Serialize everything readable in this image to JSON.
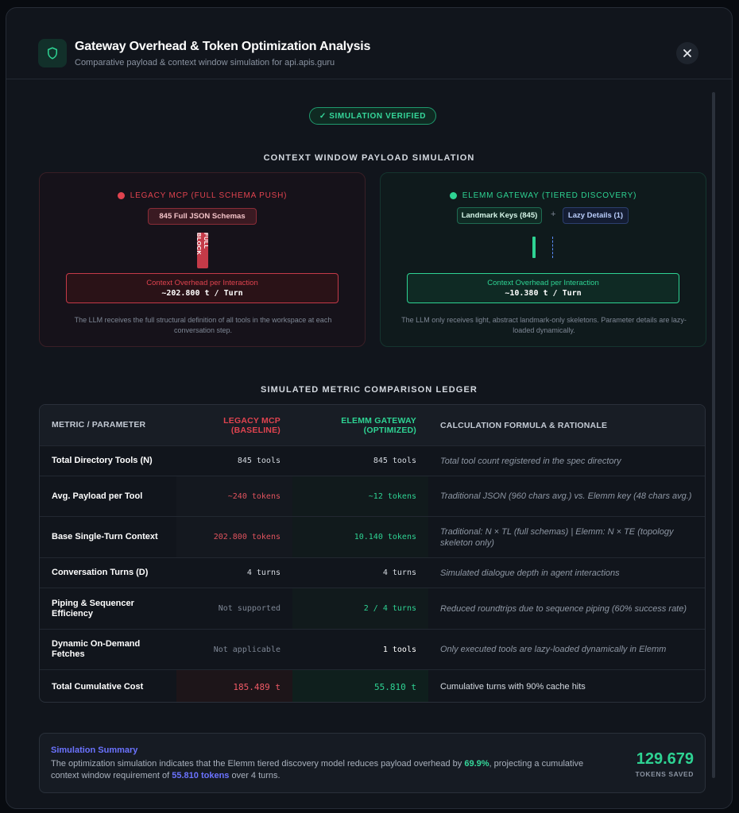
{
  "header": {
    "title": "Gateway Overhead & Token Optimization Analysis",
    "subtitle": "Comparative payload & context window simulation for api.apis.guru",
    "icon": "shield-icon",
    "close_icon": "close-icon"
  },
  "badge": "✓ SIMULATION VERIFIED",
  "simulation": {
    "heading": "CONTEXT WINDOW PAYLOAD SIMULATION",
    "legacy": {
      "title": "LEGACY MCP (FULL SCHEMA PUSH)",
      "chip": "845 Full JSON Schemas",
      "block_label": "FULL BLOCK",
      "overhead_label": "Context Overhead per Interaction",
      "overhead_value": "~202.800 t / Turn",
      "description": "The LLM receives the full structural definition of all tools in the workspace at each conversation step.",
      "color": "#e0434f"
    },
    "elemm": {
      "title": "ELEMM GATEWAY (TIERED DISCOVERY)",
      "chip_keys": "Landmark Keys (845)",
      "plus": "+",
      "chip_lazy": "Lazy Details (1)",
      "overhead_label": "Context Overhead per Interaction",
      "overhead_value": "~10.380 t / Turn",
      "description": "The LLM only receives light, abstract landmark-only skeletons. Parameter details are lazy-loaded dynamically.",
      "color": "#2ed393"
    }
  },
  "ledger": {
    "heading": "SIMULATED METRIC COMPARISON LEDGER",
    "columns": {
      "metric": "METRIC / PARAMETER",
      "legacy_line1": "LEGACY MCP",
      "legacy_line2": "(BASELINE)",
      "elemm_line1": "ELEMM GATEWAY",
      "elemm_line2": "(OPTIMIZED)",
      "formula": "CALCULATION FORMULA & RATIONALE"
    },
    "rows": [
      {
        "metric": "Total Directory Tools (N)",
        "legacy": "845 tools",
        "elemm": "845 tools",
        "formula": "Total tool count registered in the spec directory"
      },
      {
        "metric": "Avg. Payload per Tool",
        "legacy": "~240 tokens",
        "elemm": "~12 tokens",
        "formula": "Traditional JSON (960 chars avg.) vs. Elemm key (48 chars avg.)"
      },
      {
        "metric": "Base Single-Turn Context",
        "legacy": "202.800 tokens",
        "elemm": "10.140 tokens",
        "formula": "Traditional: N × TL (full schemas) | Elemm: N × TE (topology skeleton only)"
      },
      {
        "metric": "Conversation Turns (D)",
        "legacy": "4 turns",
        "elemm": "4 turns",
        "formula": "Simulated dialogue depth in agent interactions"
      },
      {
        "metric": "Piping & Sequencer Efficiency",
        "legacy": "Not supported",
        "elemm": "2 / 4 turns",
        "formula": "Reduced roundtrips due to sequence piping (60% success rate)"
      },
      {
        "metric": "Dynamic On-Demand Fetches",
        "legacy": "Not applicable",
        "elemm": "1 tools",
        "formula": "Only executed tools are lazy-loaded dynamically in Elemm"
      },
      {
        "metric": "Total Cumulative Cost",
        "legacy": "185.489 t",
        "elemm": "55.810 t",
        "formula": "Cumulative turns with 90% cache hits"
      }
    ]
  },
  "summary": {
    "title": "Simulation Summary",
    "text_part1": "The optimization simulation indicates that the Elemm tiered discovery model reduces payload overhead by ",
    "percent": "69.9%",
    "text_part2": ", projecting a cumulative context window requirement of ",
    "tokens": "55.810 tokens",
    "text_part3": " over 4 turns.",
    "saved_value": "129.679",
    "saved_label": "TOKENS SAVED"
  },
  "colors": {
    "accent_green": "#2ed393",
    "accent_red": "#e0434f",
    "accent_indigo": "#6b73ff"
  }
}
